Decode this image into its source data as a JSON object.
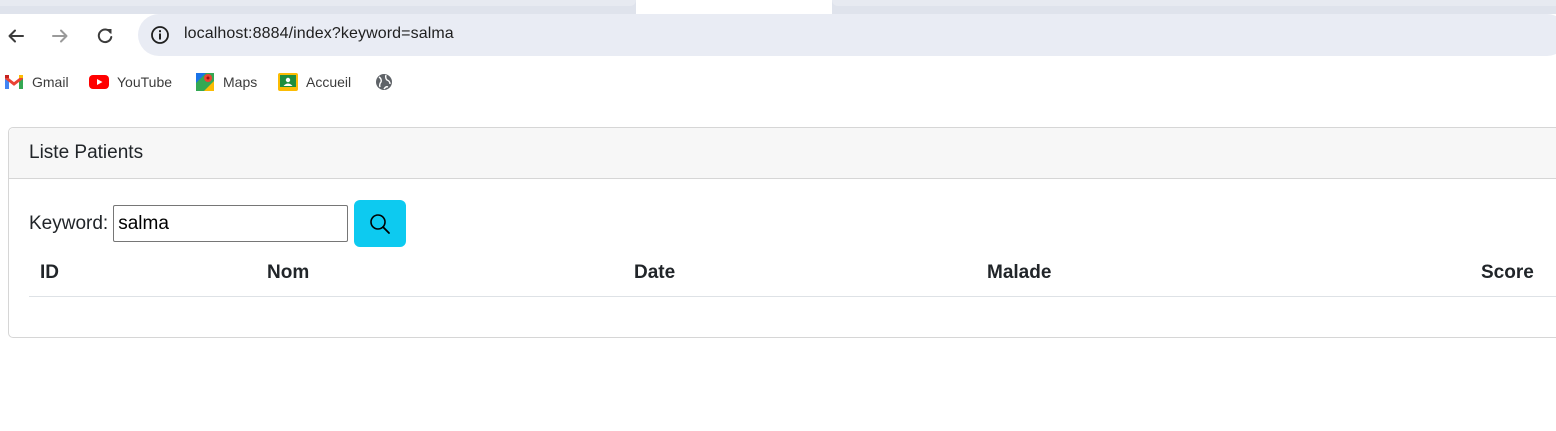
{
  "browser": {
    "url": "localhost:8884/index?keyword=salma",
    "icons": {
      "back": "arrow-left-icon",
      "forward": "arrow-right-icon",
      "reload": "reload-icon",
      "site_info": "info-circle-icon"
    }
  },
  "bookmarks": [
    {
      "label": "Gmail",
      "icon": "gmail-icon"
    },
    {
      "label": "YouTube",
      "icon": "youtube-icon"
    },
    {
      "label": "Maps",
      "icon": "maps-icon"
    },
    {
      "label": "Accueil",
      "icon": "classroom-icon"
    },
    {
      "label": "",
      "icon": "globe-icon"
    }
  ],
  "card": {
    "title": "Liste Patients",
    "search": {
      "label": "Keyword:",
      "value": "salma",
      "button_icon": "search-icon"
    },
    "table": {
      "columns": [
        "ID",
        "Nom",
        "Date",
        "Malade",
        "Score"
      ],
      "rows": []
    }
  },
  "colors": {
    "search_button": "#0dcaf0",
    "omnibox": "#e9ecf4"
  }
}
